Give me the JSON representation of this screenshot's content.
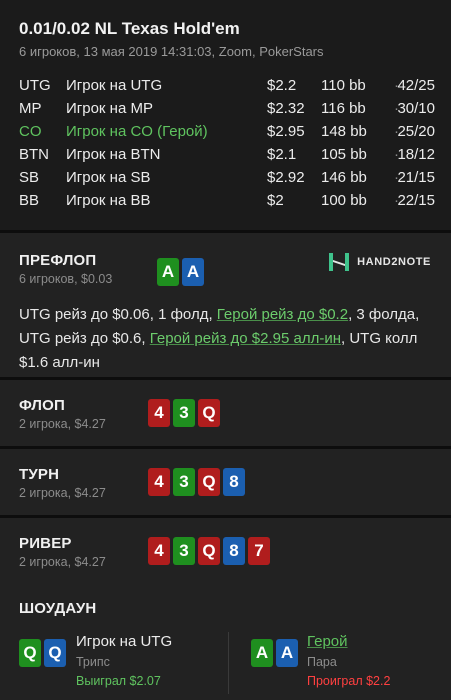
{
  "hand": {
    "title": "0.01/0.02 NL Texas Hold'em",
    "subtitle": "6 игроков, 13 мая 2019 14:31:03, Zoom, PokerStars"
  },
  "players": [
    {
      "pos": "UTG",
      "name": "Игрок на UTG",
      "stack": "$2.2",
      "bb": "110 bb",
      "sep": "·",
      "stats": "42/25",
      "hero": false
    },
    {
      "pos": "MP",
      "name": "Игрок на MP",
      "stack": "$2.32",
      "bb": "116 bb",
      "sep": "·",
      "stats": "30/10",
      "hero": false
    },
    {
      "pos": "CO",
      "name": "Игрок на CO (Герой)",
      "stack": "$2.95",
      "bb": "148 bb",
      "sep": "·",
      "stats": "25/20",
      "hero": true
    },
    {
      "pos": "BTN",
      "name": "Игрок на BTN",
      "stack": "$2.1",
      "bb": "105 bb",
      "sep": "·",
      "stats": "18/12",
      "hero": false
    },
    {
      "pos": "SB",
      "name": "Игрок на SB",
      "stack": "$2.92",
      "bb": "146 bb",
      "sep": "·",
      "stats": "21/15",
      "hero": false
    },
    {
      "pos": "BB",
      "name": "Игрок на BB",
      "stack": "$2",
      "bb": "100 bb",
      "sep": "·",
      "stats": "22/15",
      "hero": false
    }
  ],
  "preflop": {
    "title": "ПРЕФЛОП",
    "sub": "6 игроков, $0.03",
    "hero_cards": [
      {
        "rank": "A",
        "color": "green"
      },
      {
        "rank": "A",
        "color": "blue"
      }
    ],
    "logo_text": "HAND2NOTE",
    "actions": [
      {
        "text": "UTG рейз до $0.06, ",
        "hero": false
      },
      {
        "text": "1 фолд, ",
        "hero": false
      },
      {
        "text": "Герой рейз до $0.2",
        "hero": true
      },
      {
        "text": ", 3 фолда, UTG рейз до $0.6, ",
        "hero": false
      },
      {
        "text": "Герой рейз до $2.95 алл-ин",
        "hero": true
      },
      {
        "text": ", UTG колл $1.6 алл-ин",
        "hero": false
      }
    ]
  },
  "streets": [
    {
      "title": "ФЛОП",
      "sub": "2 игрока, $4.27",
      "cards": [
        {
          "rank": "4",
          "color": "red"
        },
        {
          "rank": "3",
          "color": "green"
        },
        {
          "rank": "Q",
          "color": "red"
        }
      ]
    },
    {
      "title": "ТУРН",
      "sub": "2 игрока, $4.27",
      "cards": [
        {
          "rank": "4",
          "color": "red"
        },
        {
          "rank": "3",
          "color": "green"
        },
        {
          "rank": "Q",
          "color": "red"
        },
        {
          "rank": "8",
          "color": "blue"
        }
      ]
    },
    {
      "title": "РИВЕР",
      "sub": "2 игрока, $4.27",
      "cards": [
        {
          "rank": "4",
          "color": "red"
        },
        {
          "rank": "3",
          "color": "green"
        },
        {
          "rank": "Q",
          "color": "red"
        },
        {
          "rank": "8",
          "color": "blue"
        },
        {
          "rank": "7",
          "color": "red"
        }
      ]
    }
  ],
  "showdown": {
    "title": "ШОУДАУН",
    "players": [
      {
        "name": "Игрок на UTG",
        "hand": "Трипс",
        "result": "Выиграл $2.07",
        "won": true,
        "hero": false,
        "cards": [
          {
            "rank": "Q",
            "color": "green"
          },
          {
            "rank": "Q",
            "color": "blue"
          }
        ]
      },
      {
        "name": "Герой",
        "hand": "Пара",
        "result": "Проиграл $2.2",
        "won": false,
        "hero": true,
        "cards": [
          {
            "rank": "A",
            "color": "green"
          },
          {
            "rank": "A",
            "color": "blue"
          }
        ]
      }
    ]
  },
  "colors": {
    "hero": "#5fc35f",
    "win": "#5fc35f",
    "lose": "#ff4040",
    "card_red": "#b01d1d",
    "card_green": "#1f8f1f",
    "card_blue": "#1b5fb0"
  }
}
